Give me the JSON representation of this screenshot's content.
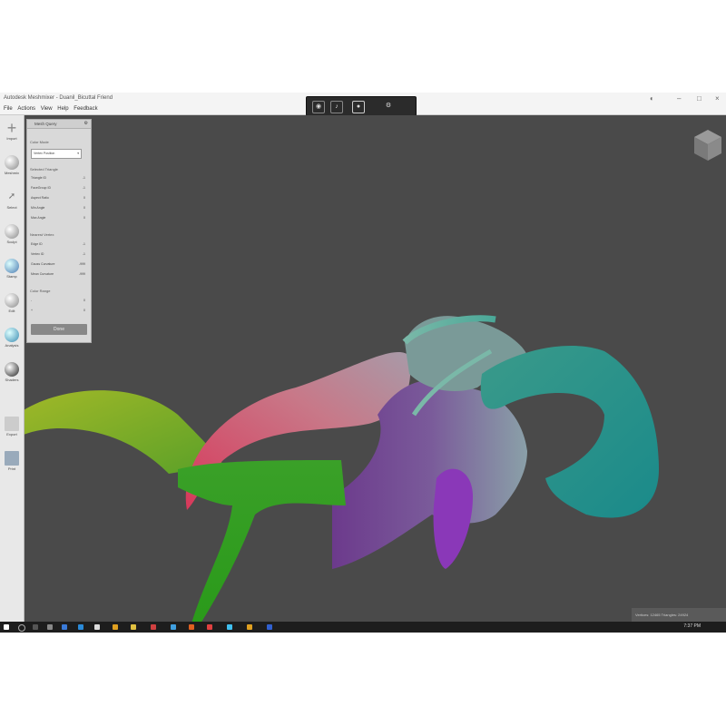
{
  "window": {
    "title": "Autodesk Meshmixer - Duanil_Bicuttal Friend",
    "controls": [
      "minimize-icon",
      "maximize-icon",
      "close-icon"
    ]
  },
  "menu": [
    "File",
    "Actions",
    "View",
    "Help",
    "Feedback"
  ],
  "capture_bar": {
    "buttons": [
      "camera-icon",
      "mic-icon",
      "record-icon",
      "settings-icon"
    ]
  },
  "tools": [
    {
      "label": "Import",
      "icon": "plus-icon"
    },
    {
      "label": "Meshmix",
      "icon": "sphere-icon"
    },
    {
      "label": "Select",
      "icon": "arrow-icon"
    },
    {
      "label": "Sculpt",
      "icon": "brush-icon"
    },
    {
      "label": "Stamp",
      "icon": "stamp-icon"
    },
    {
      "label": "Edit",
      "icon": "edit-icon"
    },
    {
      "label": "Analysis",
      "icon": "analysis-icon"
    },
    {
      "label": "Shaders",
      "icon": "shader-icon"
    },
    {
      "label": "Export",
      "icon": "export-icon"
    },
    {
      "label": "Print",
      "icon": "print-icon"
    }
  ],
  "panel": {
    "title": "Mesh Query",
    "color_mode_label": "Color Mode",
    "color_mode_value": "Vertex Position",
    "selected_triangle_label": "Selected Triangle",
    "triangle_rows": [
      {
        "label": "Triangle ID",
        "value": "-1"
      },
      {
        "label": "FaceGroup ID",
        "value": "-1"
      },
      {
        "label": "Aspect Ratio",
        "value": "0"
      },
      {
        "label": "Min Angle",
        "value": "0"
      },
      {
        "label": "Max Angle",
        "value": "0"
      }
    ],
    "nearest_vertex_label": "Nearest Vertex",
    "vertex_rows": [
      {
        "label": "Edge ID",
        "value": "-1"
      },
      {
        "label": "Vertex ID",
        "value": "-1"
      },
      {
        "label": "Gauss Curvature",
        "value": "-999"
      },
      {
        "label": "Mean Curvature",
        "value": "-999"
      }
    ],
    "color_range_label": "Color Range",
    "range_rows": [
      {
        "label": "-",
        "value": "0"
      },
      {
        "label": "+",
        "value": "0"
      }
    ],
    "done_label": "Done"
  },
  "status": {
    "text": "Vertices: 12465 Triangles: 24924"
  },
  "taskbar": {
    "clock": "7:37 PM"
  },
  "colors": {
    "viewport": "#4a4a4a",
    "toolbar": "#e8e8e8",
    "panel": "#d9d9d9",
    "taskbar": "#1d1d1d"
  }
}
